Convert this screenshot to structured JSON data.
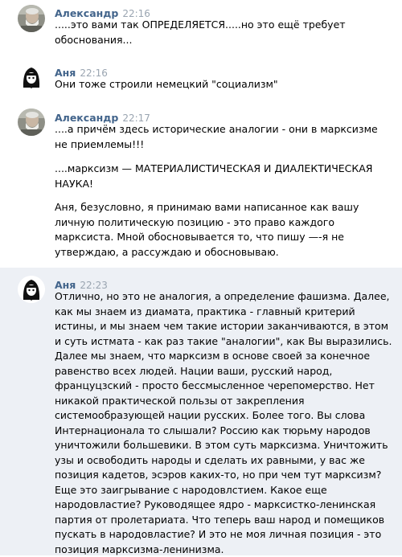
{
  "messages": [
    {
      "author": "Александр",
      "time": "22:16",
      "lines": [
        ".....это вами так ОПРЕДЕЛЯЕТСЯ.....но это ещё требует",
        "обоснования..."
      ]
    },
    {
      "author": "Аня",
      "time": "22:16",
      "lines": [
        "Они тоже строили немецкий \"социализм\""
      ]
    },
    {
      "author": "Александр",
      "time": "22:17",
      "paragraphs": [
        [
          "....а причём здесь исторические аналогии - они в марксизме",
          "не приемлемы!!!"
        ],
        [
          "....марксизм — МАТЕРИАЛИСТИЧЕСКАЯ И ДИАЛЕКТИЧЕСКАЯ",
          "НАУКА!"
        ],
        [
          "Аня, безусловно, я принимаю вами написанное как вашу",
          "личную политическую позицию - это право каждого",
          "марксиста. Мной обосновывается то, что пишу —-я не",
          "утверждаю, а рассуждаю и обосновываю."
        ]
      ]
    },
    {
      "author": "Аня",
      "time": "22:23",
      "lines": [
        "Отлично, но это не аналогия, а определение фашизма. Далее,",
        "как мы знаем из диамата, практика - главный критерий",
        "истины, и мы знаем чем такие истории заканчиваются, в этом",
        "и суть истмата - как раз такие \"аналогии\", как Вы выразились.",
        "Далее мы знаем, что марксизм в основе своей за конечное",
        "равенство всех людей. Нации ваши, русский народ,",
        "француцзский - просто бессмысленное черепомерство. Нет",
        "никакой практической пользы от закрепления",
        "системообразующей нации русских. Более того. Вы слова",
        "Интернационала то слышали? Россию как тюрьму народов",
        "уничтожили большевики. В этом суть марксизма. Уничтожить",
        "узы и освободить народы и сделать их равными, у вас же",
        "позиция кадетов, эсэров каких-то, но при чем тут марксизм?",
        "Еще это заигрывание с народовлстием. Какое еще",
        "народовластие? Руководящее ядро - марксистко-ленинская",
        "партия от пролетариата. Что теперь ваш народ и помещиков",
        "пускать в народовластие? И это не моя личная позиция - это",
        "позиция марксизма-ленинизма."
      ]
    }
  ]
}
